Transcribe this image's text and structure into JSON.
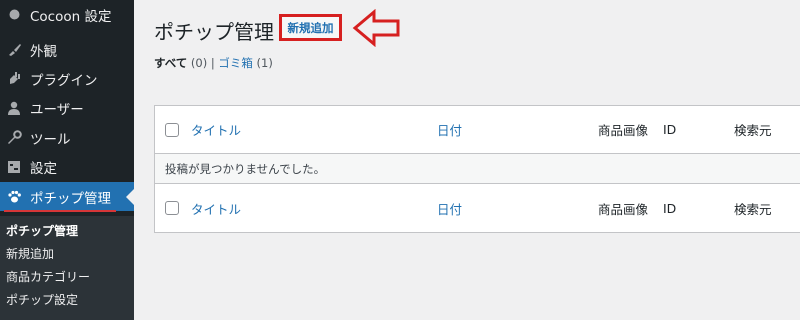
{
  "sidebar": {
    "top_item": {
      "label": "Cocoon 設定",
      "icon": "cocoon-circle-icon"
    },
    "items": [
      {
        "label": "外観",
        "icon": "paintbrush-icon"
      },
      {
        "label": "プラグイン",
        "icon": "plugin-icon"
      },
      {
        "label": "ユーザー",
        "icon": "user-icon"
      },
      {
        "label": "ツール",
        "icon": "wrench-icon"
      },
      {
        "label": "設定",
        "icon": "settings-icon"
      },
      {
        "label": "ポチップ管理",
        "icon": "paw-icon",
        "active": true
      }
    ],
    "submenu": [
      {
        "label": "ポチップ管理",
        "current": true
      },
      {
        "label": "新規追加"
      },
      {
        "label": "商品カテゴリー"
      },
      {
        "label": "ポチップ設定"
      }
    ]
  },
  "main": {
    "title": "ポチップ管理",
    "add_new_label": "新規追加",
    "views": {
      "all_label": "すべて",
      "all_count": "(0)",
      "separator": "|",
      "trash_label": "ゴミ箱",
      "trash_count": "(1)"
    },
    "table": {
      "columns": [
        "タイトル",
        "日付",
        "商品画像",
        "ID",
        "検索元"
      ],
      "empty_message": "投稿が見つかりませんでした。"
    }
  },
  "colors": {
    "sidebar_bg": "#1d2327",
    "active_bg": "#2271b1",
    "link": "#2271b1",
    "annotation_red": "#d62020"
  }
}
